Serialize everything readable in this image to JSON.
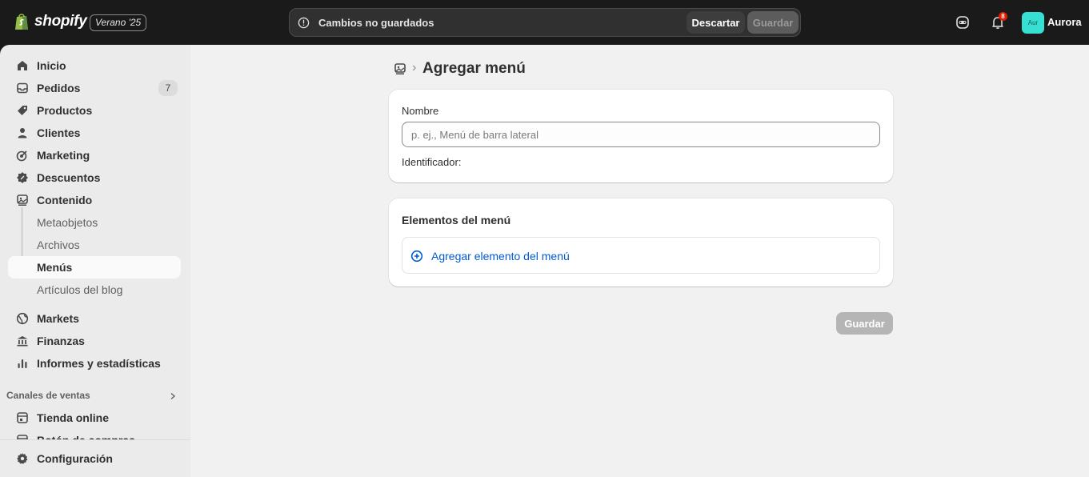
{
  "topbar": {
    "logo_text": "shopify",
    "edition": "Verano '25",
    "unsaved_message": "Cambios no guardados",
    "discard_label": "Descartar",
    "save_label": "Guardar",
    "notification_count": "8",
    "avatar_initials": "Aur",
    "user_name": "Aurora"
  },
  "sidebar": {
    "items": [
      {
        "label": "Inicio",
        "icon": "home-icon"
      },
      {
        "label": "Pedidos",
        "icon": "inbox-icon",
        "badge": "7"
      },
      {
        "label": "Productos",
        "icon": "tag-icon"
      },
      {
        "label": "Clientes",
        "icon": "person-icon"
      },
      {
        "label": "Marketing",
        "icon": "target-icon"
      },
      {
        "label": "Descuentos",
        "icon": "discount-icon"
      },
      {
        "label": "Contenido",
        "icon": "content-icon"
      }
    ],
    "content_subitems": [
      "Metaobjetos",
      "Archivos",
      "Menús",
      "Artículos del blog"
    ],
    "items2": [
      {
        "label": "Markets",
        "icon": "globe-icon"
      },
      {
        "label": "Finanzas",
        "icon": "bank-icon"
      },
      {
        "label": "Informes y estadísticas",
        "icon": "bar-chart-icon"
      }
    ],
    "sales_channels_heading": "Canales de ventas",
    "channels": [
      {
        "label": "Tienda online",
        "icon": "store-icon"
      },
      {
        "label": "Botón de compras",
        "icon": "buy-button-icon"
      }
    ],
    "settings_label": "Configuración"
  },
  "main": {
    "page_title": "Agregar menú",
    "name_label": "Nombre",
    "name_placeholder": "p. ej., Menú de barra lateral",
    "name_value": "",
    "identifier_label": "Identificador:",
    "menu_items_title": "Elementos del menú",
    "add_item_label": "Agregar elemento del menú",
    "save_label": "Guardar"
  },
  "colors": {
    "accent_link": "#005bd3",
    "topbar_bg": "#1a1a1a",
    "avatar_bg": "#36e0d2",
    "badge_red": "#e51c00"
  }
}
